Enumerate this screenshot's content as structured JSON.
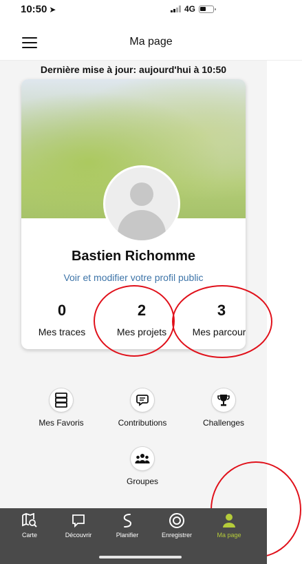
{
  "status_bar": {
    "time": "10:50",
    "network": "4G"
  },
  "header": {
    "title": "Ma page"
  },
  "last_update": "Dernière mise à jour: aujourd'hui à 10:50",
  "profile": {
    "name": "Bastien Richomme",
    "link": "Voir et modifier votre profil public",
    "stats": [
      {
        "value": "0",
        "label": "Mes traces"
      },
      {
        "value": "2",
        "label": "Mes projets"
      },
      {
        "value": "3",
        "label": "Mes parcours"
      }
    ]
  },
  "menu": [
    {
      "label": "Mes Favoris",
      "icon": "favorites-list-icon"
    },
    {
      "label": "Contributions",
      "icon": "chat-bubble-icon"
    },
    {
      "label": "Challenges",
      "icon": "trophy-icon"
    },
    {
      "label": "Groupes",
      "icon": "group-icon"
    }
  ],
  "tab_bar": {
    "tabs": [
      {
        "label": "Carte",
        "icon": "map-search-icon"
      },
      {
        "label": "Découvrir",
        "icon": "speech-bubble-icon"
      },
      {
        "label": "Planifier",
        "icon": "route-icon"
      },
      {
        "label": "Enregistrer",
        "icon": "record-icon"
      },
      {
        "label": "Ma page",
        "icon": "user-icon"
      }
    ],
    "active": "Ma page"
  },
  "colors": {
    "accent": "#b5cc3a",
    "link": "#3d74a8",
    "annotation": "#e0101a",
    "tab_bar": "#4a4a4a"
  }
}
